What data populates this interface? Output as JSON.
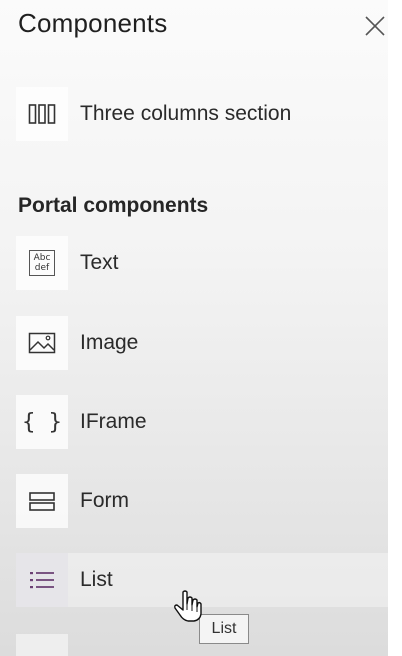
{
  "panel": {
    "title": "Components",
    "close_label": "Close"
  },
  "layout_section": {
    "items": [
      {
        "label": "Three columns section",
        "icon": "three-columns-icon"
      }
    ]
  },
  "portal_section": {
    "title": "Portal components",
    "items": [
      {
        "label": "Text",
        "icon": "text-abc-def-icon",
        "icon_text_top": "Abc",
        "icon_text_bottom": "def"
      },
      {
        "label": "Image",
        "icon": "image-icon"
      },
      {
        "label": "IFrame",
        "icon": "braces-icon",
        "icon_text": "{ }"
      },
      {
        "label": "Form",
        "icon": "form-icon"
      },
      {
        "label": "List",
        "icon": "list-icon"
      }
    ]
  },
  "tooltip": {
    "text": "List"
  },
  "colors": {
    "list_icon_accent": "#6b3f73",
    "panel_bg_top": "#fbfbfb",
    "panel_bg_bottom": "#dcdcdc"
  }
}
